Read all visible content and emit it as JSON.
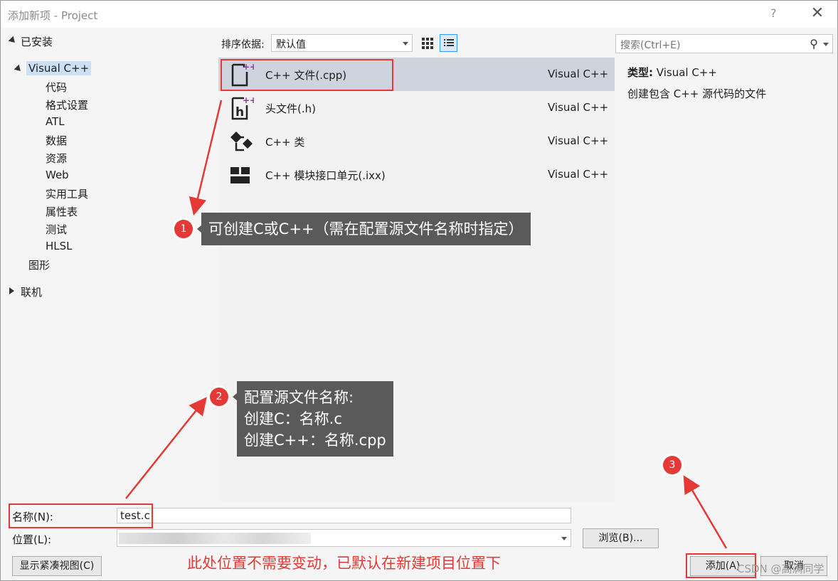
{
  "window": {
    "title": "添加新项 - Project",
    "help_label": "?",
    "close_label": "✕"
  },
  "tree": {
    "installed": "已安装",
    "visual_cpp": "Visual C++",
    "children": [
      "代码",
      "格式设置",
      "ATL",
      "数据",
      "资源",
      "Web",
      "实用工具",
      "属性表",
      "测试",
      "HLSL"
    ],
    "graphics": "图形",
    "online": "联机"
  },
  "sort": {
    "label": "排序依据:",
    "value": "默认值"
  },
  "templates": [
    {
      "name": "C++ 文件(.cpp)",
      "lang": "Visual C++",
      "icon": "cpp-file-icon"
    },
    {
      "name": "头文件(.h)",
      "lang": "Visual C++",
      "icon": "header-file-icon"
    },
    {
      "name": "C++ 类",
      "lang": "Visual C++",
      "icon": "cpp-class-icon"
    },
    {
      "name": "C++ 模块接口单元(.ixx)",
      "lang": "Visual C++",
      "icon": "module-icon"
    }
  ],
  "search": {
    "placeholder": "搜索(Ctrl+E)"
  },
  "details": {
    "type_label": "类型:",
    "type_value": "Visual C++",
    "description": "创建包含 C++ 源代码的文件"
  },
  "form": {
    "name_label": "名称(N):",
    "name_value": "test.c",
    "location_label": "位置(L):",
    "browse": "浏览(B)...",
    "compact_view": "显示紧凑视图(C)",
    "add": "添加(A)",
    "cancel": "取消"
  },
  "annotations": {
    "badge1": "1",
    "callout1": "可创建C或C++（需在配置源文件名称时指定）",
    "badge2": "2",
    "callout2_line1": "配置源文件名称:",
    "callout2_line2": "创建C：名称.c",
    "callout2_line3": "创建C++：名称.cpp",
    "badge3": "3",
    "location_note": "此处位置不需要变动，已默认在新建项目位置下"
  },
  "watermark": "CSDN @高满同学",
  "colors": {
    "annotation_red": "#e53935",
    "selection": "#cfd3dd",
    "callout_bg": "#5a5a5a"
  }
}
